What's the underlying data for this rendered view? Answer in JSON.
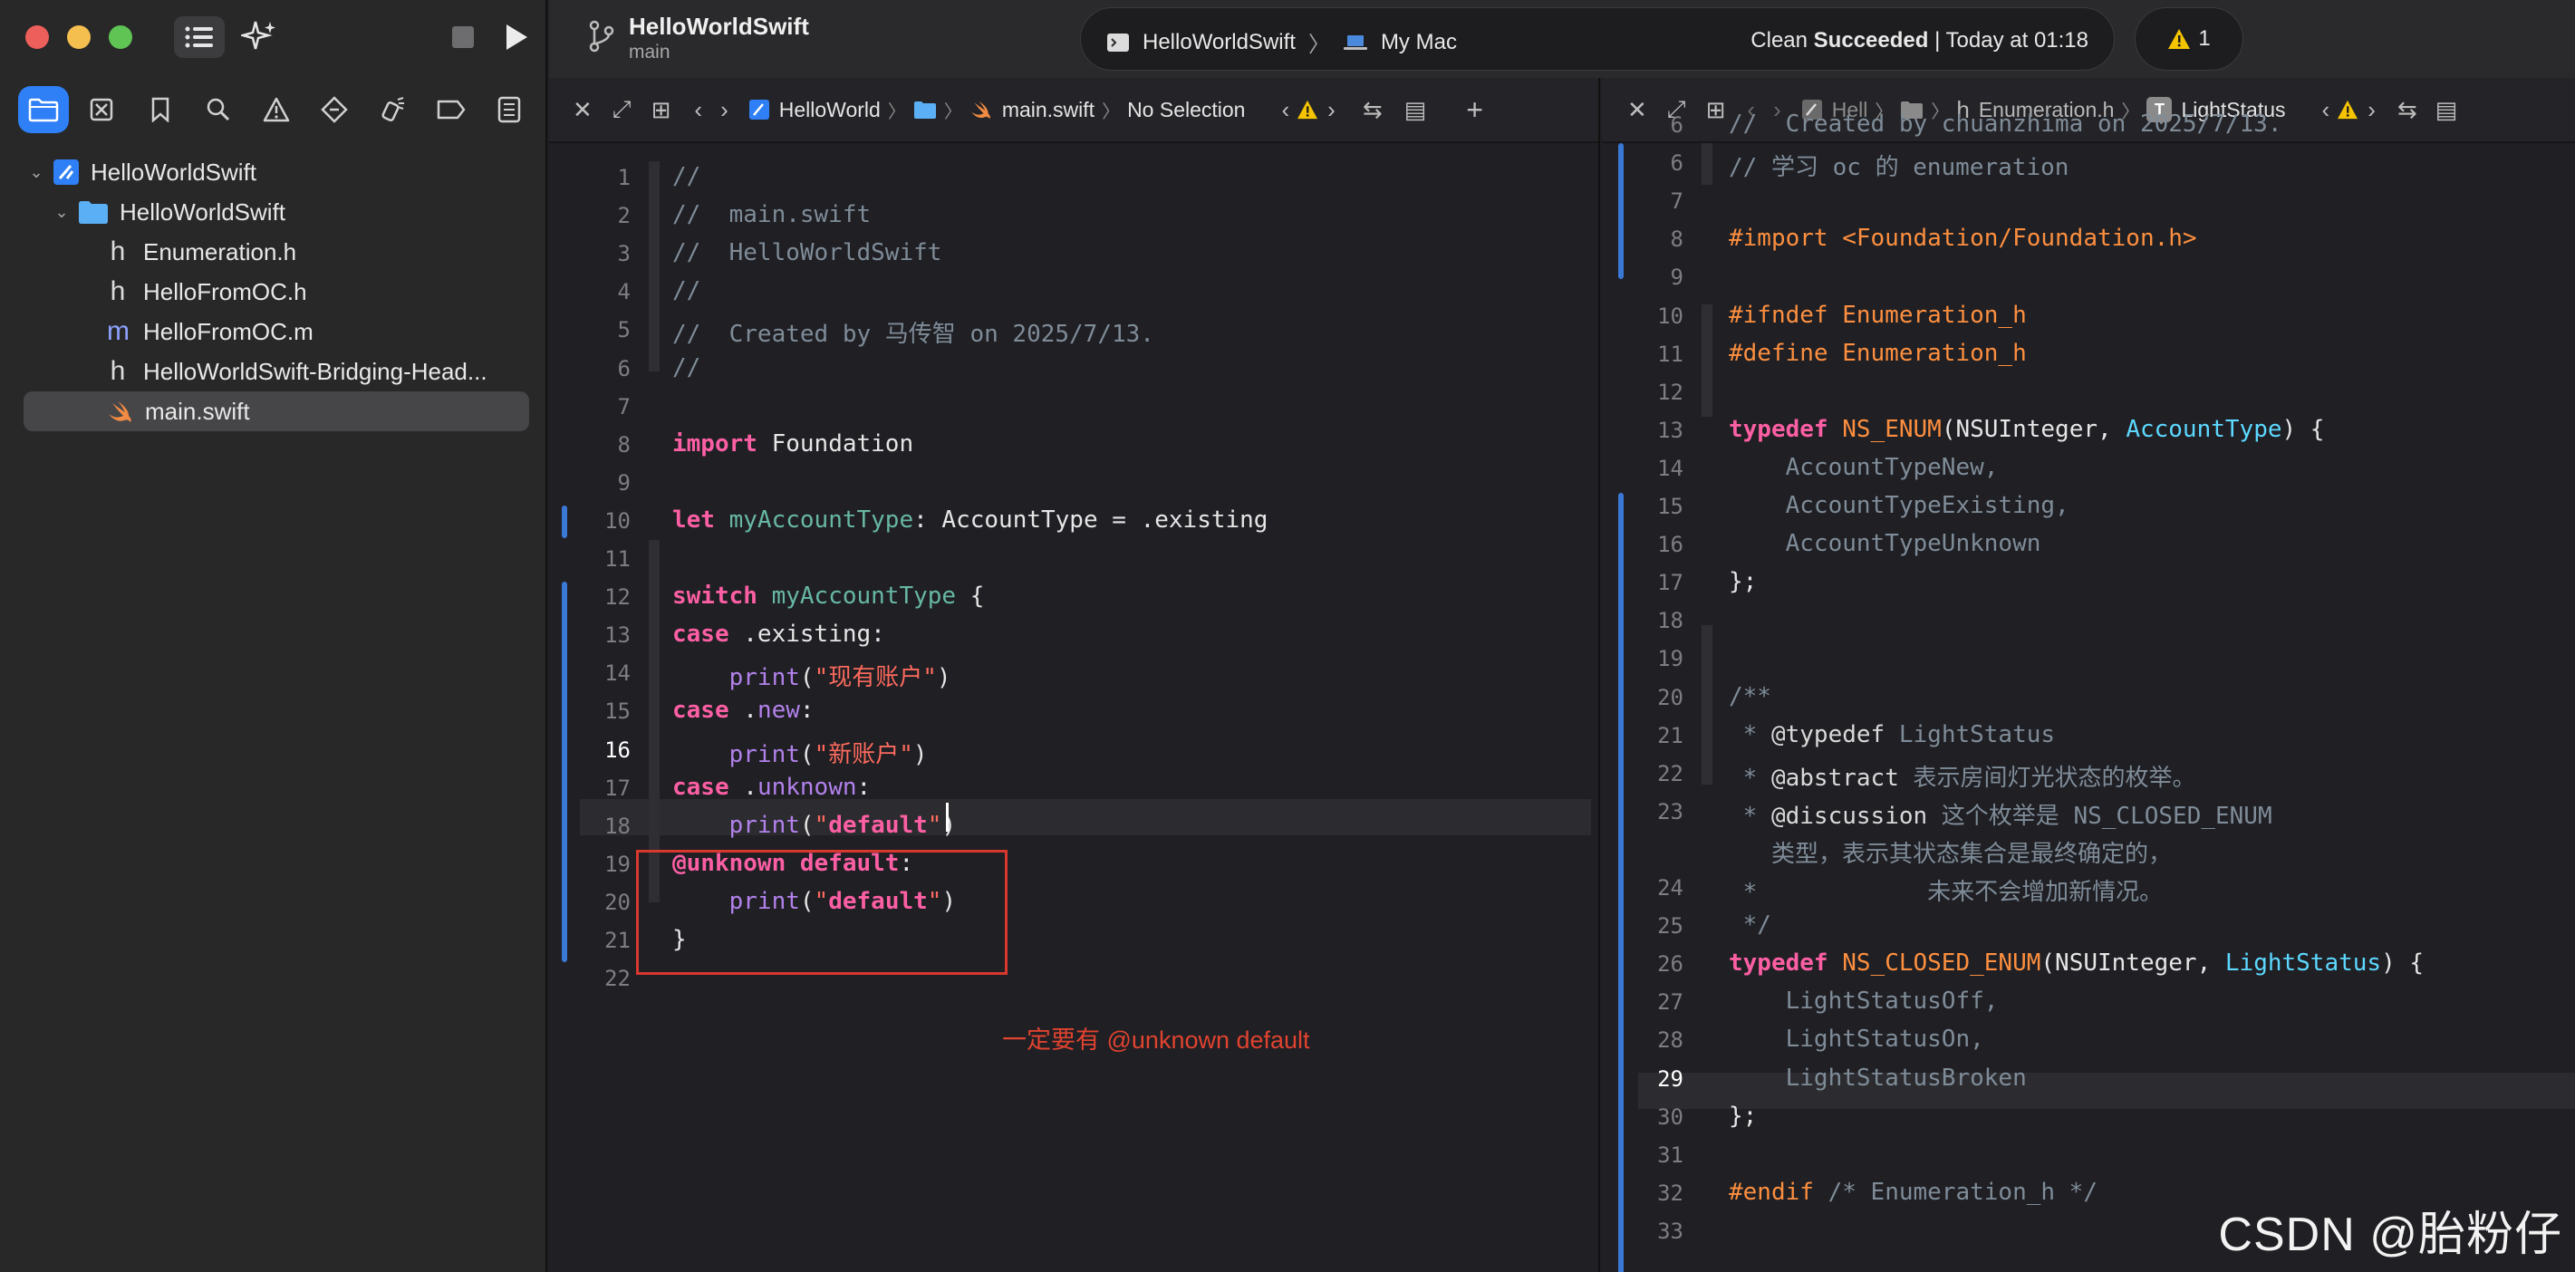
{
  "sidebar": {
    "tree": [
      {
        "label": "HelloWorldSwift",
        "kind": "project",
        "level": 0
      },
      {
        "label": "HelloWorldSwift",
        "kind": "folder",
        "level": 1
      },
      {
        "label": "Enumeration.h",
        "kind": "h",
        "level": 2
      },
      {
        "label": "HelloFromOC.h",
        "kind": "h",
        "level": 2
      },
      {
        "label": "HelloFromOC.m",
        "kind": "m",
        "level": 2
      },
      {
        "label": "HelloWorldSwift-Bridging-Head...",
        "kind": "h",
        "level": 2
      },
      {
        "label": "main.swift",
        "kind": "swift",
        "level": 2,
        "selected": true
      }
    ],
    "file_glyph_h": "h",
    "file_glyph_m": "m"
  },
  "toolbar": {
    "project_title": "HelloWorldSwift",
    "branch": "main",
    "run_target": "HelloWorldSwift",
    "run_destination": "My Mac",
    "status_strong": "Succeeded",
    "status_prefix": "Clean ",
    "status_suffix": " | Today at 01:18",
    "warning_count": "1"
  },
  "left_editor": {
    "jumpbar": {
      "project": "HelloWorld",
      "file": "main.swift",
      "selection": "No Selection"
    },
    "current_line": 16,
    "lines": [
      "//",
      "//  main.swift",
      "//  HelloWorldSwift",
      "//",
      "//  Created by 马传智 on 2025/7/13.",
      "//",
      "",
      "import Foundation",
      "",
      "let myAccountType: AccountType = .existing",
      "",
      "switch myAccountType {",
      "case .existing:",
      "    print(\"现有账户\")",
      "case .new:",
      "    print(\"新账户\")",
      "case .unknown:",
      "    print(\"default\")",
      "@unknown default:",
      "    print(\"default\")",
      "}",
      ""
    ]
  },
  "right_editor": {
    "jumpbar": {
      "project": "Hell",
      "file": "Enumeration.h",
      "symbol": "LightStatus",
      "symbol_badge": "T"
    },
    "current_line": 29,
    "line_numbers": [
      "6",
      "6",
      "7",
      "8",
      "9",
      "10",
      "11",
      "12",
      "13",
      "14",
      "15",
      "16",
      "17",
      "18",
      "19",
      "20",
      "21",
      "22",
      "23",
      "",
      "24",
      "25",
      "26",
      "27",
      "28",
      "29",
      "30",
      "31",
      "32",
      "33"
    ],
    "lines": [
      "//  Created by chuanzhima on 2025/7/13.",
      "// 学习 oc 的 enumeration",
      "",
      "#import <Foundation/Foundation.h>",
      "",
      "#ifndef Enumeration_h",
      "#define Enumeration_h",
      "",
      "typedef NS_ENUM(NSUInteger, AccountType) {",
      "    AccountTypeNew,",
      "    AccountTypeExisting,",
      "    AccountTypeUnknown",
      "};",
      "",
      "",
      "/**",
      " * @typedef LightStatus",
      " * @abstract 表示房间灯光状态的枚举。",
      " * @discussion 这个枚举是 NS_CLOSED_ENUM",
      "   类型，表示其状态集合是最终确定的，",
      " *            未来不会增加新情况。",
      " */",
      "typedef NS_CLOSED_ENUM(NSUInteger, LightStatus) {",
      "    LightStatusOff,",
      "    LightStatusOn,",
      "    LightStatusBroken",
      "};",
      "",
      "#endif /* Enumeration_h */",
      ""
    ]
  },
  "annotation": {
    "note": "一定要有 @unknown default",
    "color": "#e0432f"
  },
  "watermark": "CSDN @胎粉仔",
  "colors": {
    "accent": "#2f7ff6",
    "keyword": "#fc5fa3",
    "string": "#fc6a5d",
    "type": "#5dd8ff",
    "preprocessor": "#fd8f3f",
    "comment": "#7f8c98",
    "warning": "#f5c400"
  }
}
